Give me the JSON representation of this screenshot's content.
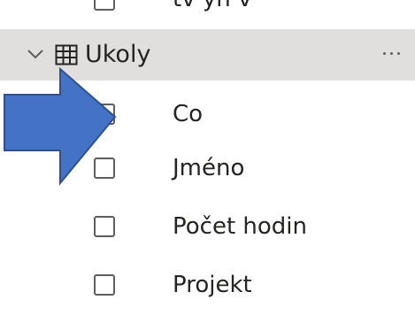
{
  "previous_row": {
    "text": "tv yh v"
  },
  "table": {
    "name": "Ukoly",
    "more_label": "···",
    "fields": [
      {
        "label": "Co",
        "checked": false
      },
      {
        "label": "Jméno",
        "checked": false
      },
      {
        "label": "Počet hodin",
        "checked": false
      },
      {
        "label": "Projekt",
        "checked": false
      }
    ]
  },
  "colors": {
    "header_background": "#e1dfdd",
    "text": "#252423",
    "checkbox_border": "#605e5c",
    "arrow_fill": "#4472c4",
    "arrow_stroke": "#2f528f"
  },
  "icons": {
    "chevron": "chevron-down-icon",
    "table": "table-icon",
    "arrow": "arrow-right-icon"
  }
}
